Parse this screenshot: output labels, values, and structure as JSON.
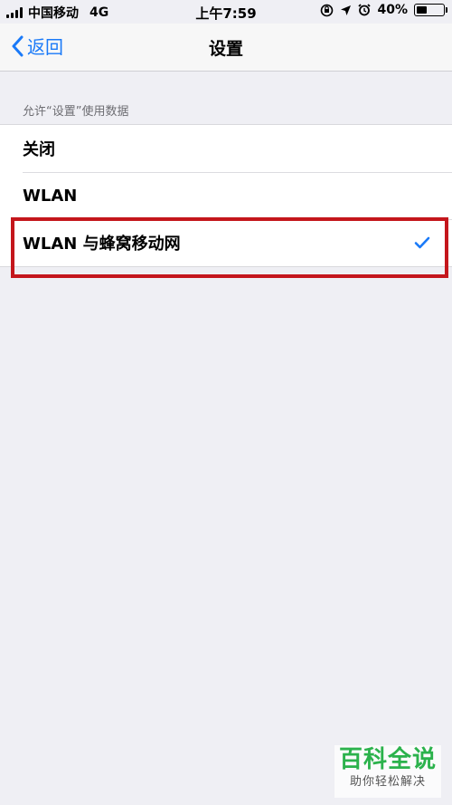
{
  "status_bar": {
    "carrier": "中国移动",
    "network": "4G",
    "time": "上午7:59",
    "battery": "40%",
    "battery_level": 0.4
  },
  "nav": {
    "back_label": "返回",
    "title": "设置"
  },
  "section": {
    "header": "允许“设置”使用数据",
    "options": [
      {
        "label": "关闭",
        "selected": false
      },
      {
        "label": "WLAN",
        "selected": false
      },
      {
        "label": "WLAN 与蜂窝移动网",
        "selected": true
      }
    ]
  },
  "watermark": {
    "title": "百科全说",
    "subtitle": "助你轻松解决"
  },
  "colors": {
    "accent": "#1a7af8",
    "highlight": "#c4161c",
    "background": "#efeff4",
    "watermark_green": "#2bb24c"
  }
}
